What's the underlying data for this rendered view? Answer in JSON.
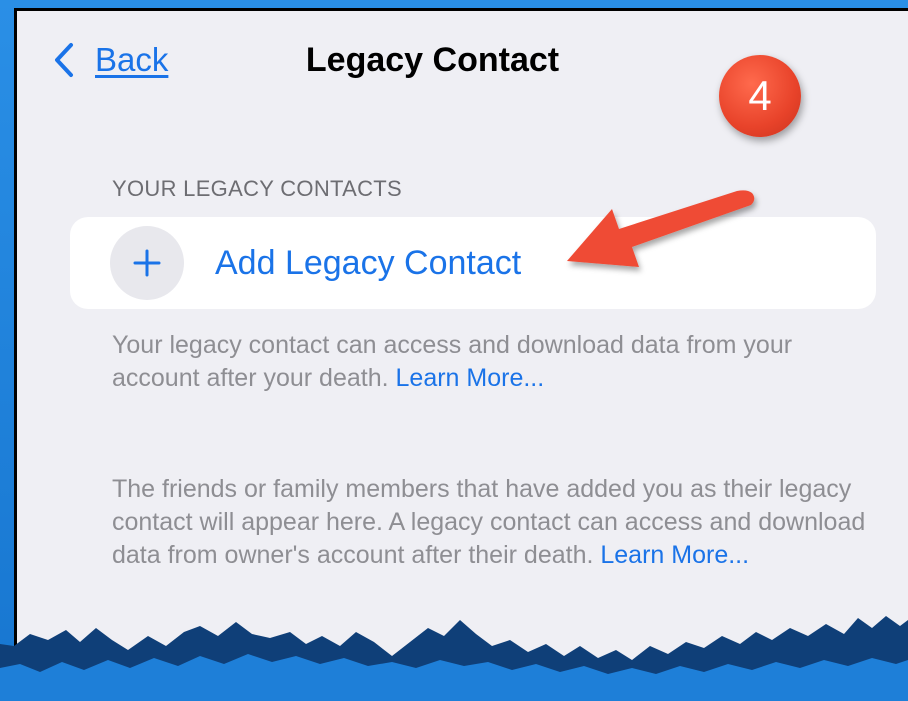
{
  "navbar": {
    "back_label": "Back",
    "title": "Legacy Contact"
  },
  "annotation": {
    "step_number": "4"
  },
  "section": {
    "header": "YOUR LEGACY CONTACTS",
    "add_button_label": "Add Legacy Contact"
  },
  "description1": {
    "text": "Your legacy contact can access and download data from your account after your death.",
    "link": "Learn More..."
  },
  "description2": {
    "text": "The friends or family members that have added you as their legacy contact will appear here. A legacy contact can access and download data from owner's account after their death.",
    "link": "Learn More..."
  },
  "colors": {
    "accent": "#1a73e8",
    "background": "#efeff4",
    "badge": "#e8432a",
    "frame": "#1e7fd8"
  }
}
